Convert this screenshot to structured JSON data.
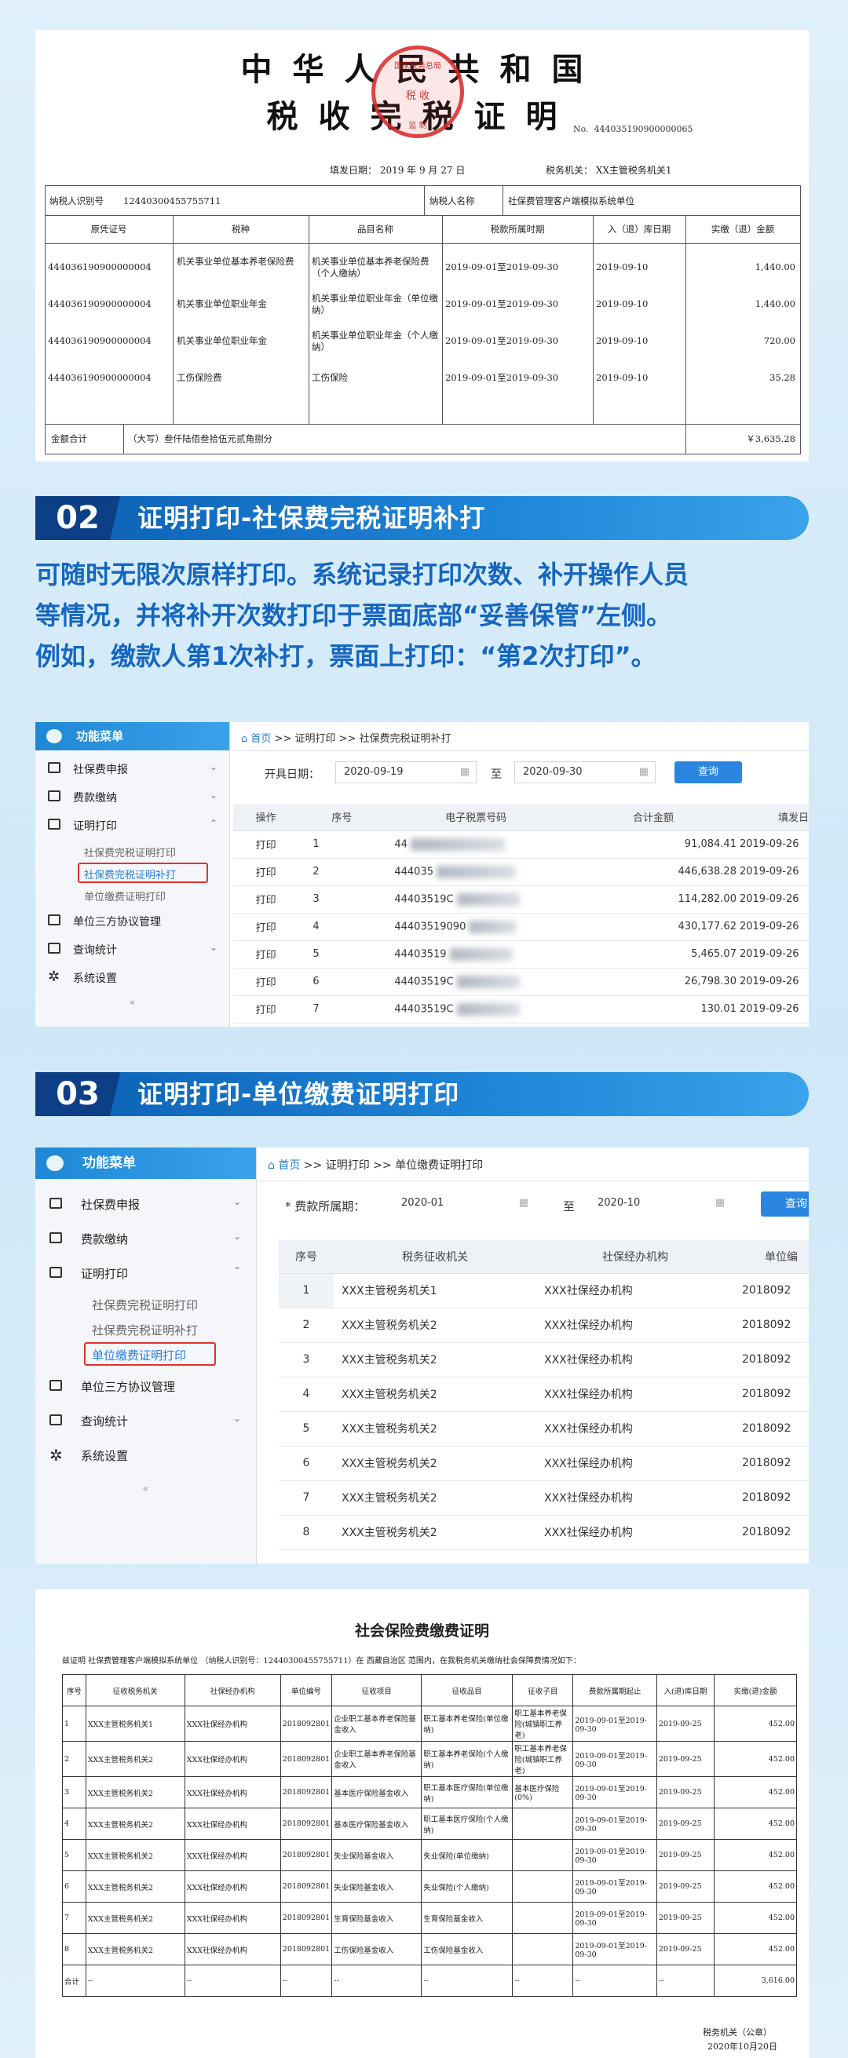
{
  "cert1": {
    "title1": "中华人民共和国",
    "title2": "税收完税证明",
    "seal_top": "国家税务总局",
    "seal_mid": "税 收",
    "seal_bot": "监 制",
    "no_label": "No.",
    "no_value": "444035190900000065",
    "fill_date": "填发日期： 2019 年 9 月 27 日",
    "tax_org": "税务机关： XX主管税务机关1",
    "payer_id_label": "纳税人识别号",
    "payer_id": "12440300455755711",
    "payer_name_label": "纳税人名称",
    "payer_name": "社保费管理客户端模拟系统单位",
    "headers": [
      "原凭证号",
      "税种",
      "品目名称",
      "税款所属时期",
      "入（退）库日期",
      "实缴（退）金额"
    ],
    "rows": [
      [
        "444036190900000004",
        "机关事业单位基本养老保险费",
        "机关事业单位基本养老保险费（个人缴纳）",
        "2019-09-01至2019-09-30",
        "2019-09-10",
        "1,440.00"
      ],
      [
        "444036190900000004",
        "机关事业单位职业年金",
        "机关事业单位职业年金（单位缴纳）",
        "2019-09-01至2019-09-30",
        "2019-09-10",
        "1,440.00"
      ],
      [
        "444036190900000004",
        "机关事业单位职业年金",
        "机关事业单位职业年金（个人缴纳）",
        "2019-09-01至2019-09-30",
        "2019-09-10",
        "720.00"
      ],
      [
        "444036190900000004",
        "工伤保险费",
        "工伤保险",
        "2019-09-01至2019-09-30",
        "2019-09-10",
        "35.28"
      ]
    ],
    "total_label": "金额合计",
    "total_words": "（大写）叁仟陆佰叁拾伍元贰角捌分",
    "total_value": "￥3,635.28"
  },
  "section02": {
    "num": "02",
    "title": "证明打印-社保费完税证明补打",
    "desc": [
      "可随时无限次原样打印。系统记录打印次数、补开操作人员",
      "等情况，并将补开次数打印于票面底部“妥善保管”左侧。",
      "例如，缴款人第1次补打，票面上打印：“第2次打印”。"
    ]
  },
  "shot1": {
    "menu_title": "功能菜单",
    "menu": [
      "社保费申报",
      "费款缴纳",
      "证明打印",
      "单位三方协议管理",
      "查询统计",
      "系统设置"
    ],
    "submenu": [
      "社保费完税证明打印",
      "社保费完税证明补打",
      "单位缴费证明打印"
    ],
    "collapse": "«",
    "crumb_home": "首页",
    "crumb_rest": " >> 证明打印 >> 社保费完税证明补打",
    "start_label": "开具日期：",
    "start_date": "2020-09-19",
    "to": "至",
    "end_date": "2020-09-30",
    "query": "查询",
    "headers": [
      "操作",
      "序号",
      "电子税票号码",
      "合计金额",
      "填发日"
    ],
    "rows": [
      [
        "打印",
        "1",
        "44",
        "91,084.41",
        "2019-09-26"
      ],
      [
        "打印",
        "2",
        "444035",
        "446,638.28",
        "2019-09-26"
      ],
      [
        "打印",
        "3",
        "44403519C",
        "114,282.00",
        "2019-09-26"
      ],
      [
        "打印",
        "4",
        "44403519090",
        "430,177.62",
        "2019-09-26"
      ],
      [
        "打印",
        "5",
        "44403519",
        "5,465.07",
        "2019-09-26"
      ],
      [
        "打印",
        "6",
        "44403519C",
        "26,798.30",
        "2019-09-26"
      ],
      [
        "打印",
        "7",
        "44403519C",
        "130.01",
        "2019-09-26"
      ]
    ]
  },
  "section03": {
    "num": "03",
    "title": "证明打印-单位缴费证明打印"
  },
  "shot2": {
    "menu_title": "功能菜单",
    "menu": [
      "社保费申报",
      "费款缴纳",
      "证明打印",
      "单位三方协议管理",
      "查询统计",
      "系统设置"
    ],
    "submenu": [
      "社保费完税证明打印",
      "社保费完税证明补打",
      "单位缴费证明打印"
    ],
    "collapse": "«",
    "crumb_home": "首页",
    "crumb_rest": " >> 证明打印 >> 单位缴费证明打印",
    "period_label": "* 费款所属期：",
    "start": "2020-01",
    "to": "至",
    "end": "2020-10",
    "query": "查询",
    "headers": [
      "序号",
      "税务征收机关",
      "社保经办机构",
      "单位编"
    ],
    "rows": [
      [
        "1",
        "XXX主管税务机关1",
        "XXX社保经办机构",
        "2018092"
      ],
      [
        "2",
        "XXX主管税务机关2",
        "XXX社保经办机构",
        "2018092"
      ],
      [
        "3",
        "XXX主管税务机关2",
        "XXX社保经办机构",
        "2018092"
      ],
      [
        "4",
        "XXX主管税务机关2",
        "XXX社保经办机构",
        "2018092"
      ],
      [
        "5",
        "XXX主管税务机关2",
        "XXX社保经办机构",
        "2018092"
      ],
      [
        "6",
        "XXX主管税务机关2",
        "XXX社保经办机构",
        "2018092"
      ],
      [
        "7",
        "XXX主管税务机关2",
        "XXX社保经办机构",
        "2018092"
      ],
      [
        "8",
        "XXX主管税务机关2",
        "XXX社保经办机构",
        "2018092"
      ]
    ]
  },
  "cert2": {
    "title": "社会保险费缴费证明",
    "intro": "兹证明  社保费管理客户端模拟系统单位  （纳税人识别号：12440300455755711）在 西藏自治区 范围内，在我税务机关缴纳社会保障费情况如下：",
    "headers": [
      "序号",
      "征收税务机关",
      "社保经办机构",
      "单位编号",
      "征收项目",
      "征收品目",
      "征收子目",
      "费款所属期起止",
      "入(退)库日期",
      "实缴(退)金额"
    ],
    "rows": [
      [
        "1",
        "XXX主管税务机关1",
        "XXX社保经办机构",
        "2018092801",
        "企业职工基本养老保险基金收入",
        "职工基本养老保险(单位缴纳)",
        "职工基本养老保险(城镇职工养老)",
        "2019-09-01至2019-09-30",
        "2019-09-25",
        "452.00"
      ],
      [
        "2",
        "XXX主管税务机关2",
        "XXX社保经办机构",
        "2018092801",
        "企业职工基本养老保险基金收入",
        "职工基本养老保险(个人缴纳)",
        "职工基本养老保险(城镇职工养老)",
        "2019-09-01至2019-09-30",
        "2019-09-25",
        "452.00"
      ],
      [
        "3",
        "XXX主管税务机关2",
        "XXX社保经办机构",
        "2018092801",
        "基本医疗保险基金收入",
        "职工基本医疗保险(单位缴纳)",
        "基本医疗保险(0%)",
        "2019-09-01至2019-09-30",
        "2019-09-25",
        "452.00"
      ],
      [
        "4",
        "XXX主管税务机关2",
        "XXX社保经办机构",
        "2018092801",
        "基本医疗保险基金收入",
        "职工基本医疗保险(个人缴纳)",
        "",
        "2019-09-01至2019-09-30",
        "2019-09-25",
        "452.00"
      ],
      [
        "5",
        "XXX主管税务机关2",
        "XXX社保经办机构",
        "2018092801",
        "失业保险基金收入",
        "失业保险(单位缴纳)",
        "",
        "2019-09-01至2019-09-30",
        "2019-09-25",
        "452.00"
      ],
      [
        "6",
        "XXX主管税务机关2",
        "XXX社保经办机构",
        "2018092801",
        "失业保险基金收入",
        "失业保险(个人缴纳)",
        "",
        "2019-09-01至2019-09-30",
        "2019-09-25",
        "452.00"
      ],
      [
        "7",
        "XXX主管税务机关2",
        "XXX社保经办机构",
        "2018092801",
        "生育保险基金收入",
        "生育保险基金收入",
        "",
        "2019-09-01至2019-09-30",
        "2019-09-25",
        "452.00"
      ],
      [
        "8",
        "XXX主管税务机关2",
        "XXX社保经办机构",
        "2018092801",
        "工伤保险基金收入",
        "工伤保险基金收入",
        "",
        "2019-09-01至2019-09-30",
        "2019-09-25",
        "452.00"
      ]
    ],
    "total_row": [
      "合计",
      "--",
      "--",
      "--",
      "--",
      "--",
      "--",
      "--",
      "--",
      "3,616.00"
    ],
    "stamp_label": "税务机关（公章）",
    "stamp_date": "2020年10月20日"
  },
  "colors": {
    "accent": "#1f86d8",
    "banner_dark": "#0d3f86",
    "text_blue": "#1566c0",
    "red": "#e23030"
  }
}
